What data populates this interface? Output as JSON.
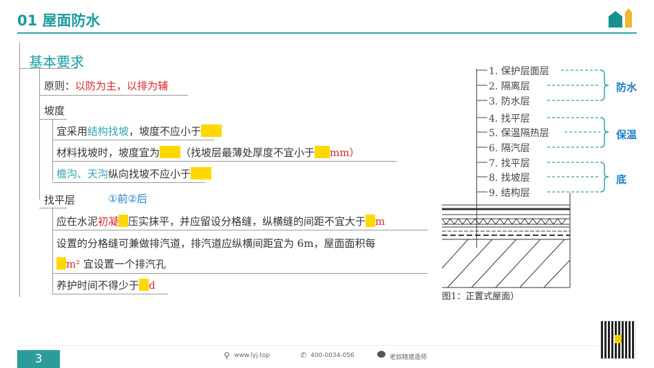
{
  "header": {
    "title": "01  屋面防水"
  },
  "outline": {
    "heading": "基本要求",
    "principle": {
      "label": "原则：",
      "value": "以防为主，以排为辅"
    },
    "slope": {
      "heading": "坡度",
      "line1": {
        "a": "宜采用",
        "b": "结构找坡",
        "c": "，坡度不应小于"
      },
      "line2": {
        "a": "材料找坡时，坡度宜为",
        "b": "（找坡层最薄处厚度不宜小于",
        "c": "mm）"
      },
      "line3": {
        "a": "檐沟、天沟",
        "b": "纵向找坡不应小于"
      }
    },
    "leveling": {
      "heading": "找平层",
      "note": "①前②后",
      "line1": {
        "a": "应在水泥",
        "b": "初凝",
        "c": "压实抹平，并应留设分格缝，纵横缝的间距不宜大于",
        "d": "m"
      },
      "line2": "设置的分格缝可兼做排汽道，排汽道应纵横间距宜为 6m，屋面面积每",
      "line3": {
        "a": "m²",
        "b": " 宜设置一个排汽孔"
      },
      "line4": {
        "a": "养护时间不得少于",
        "b": "d"
      }
    }
  },
  "diagram": {
    "layers": [
      "1. 保护层面层",
      "2. 隔离层",
      "3. 防水层",
      "4. 找平层",
      "5. 保温隔热层",
      "6. 隔汽层",
      "7. 找平层",
      "8. 找坡层",
      "9. 结构层"
    ],
    "groups": [
      "防水",
      "保温",
      "底"
    ],
    "caption": "图1：正置式屋面）"
  },
  "footer": {
    "page": "3",
    "website": "www.lyj.top",
    "phone": "400-0034-056",
    "wechat": "老奴精建造师"
  },
  "colors": {
    "accent": "#2aa5a5",
    "red": "#d9262b",
    "highlight": "#ffd800"
  }
}
